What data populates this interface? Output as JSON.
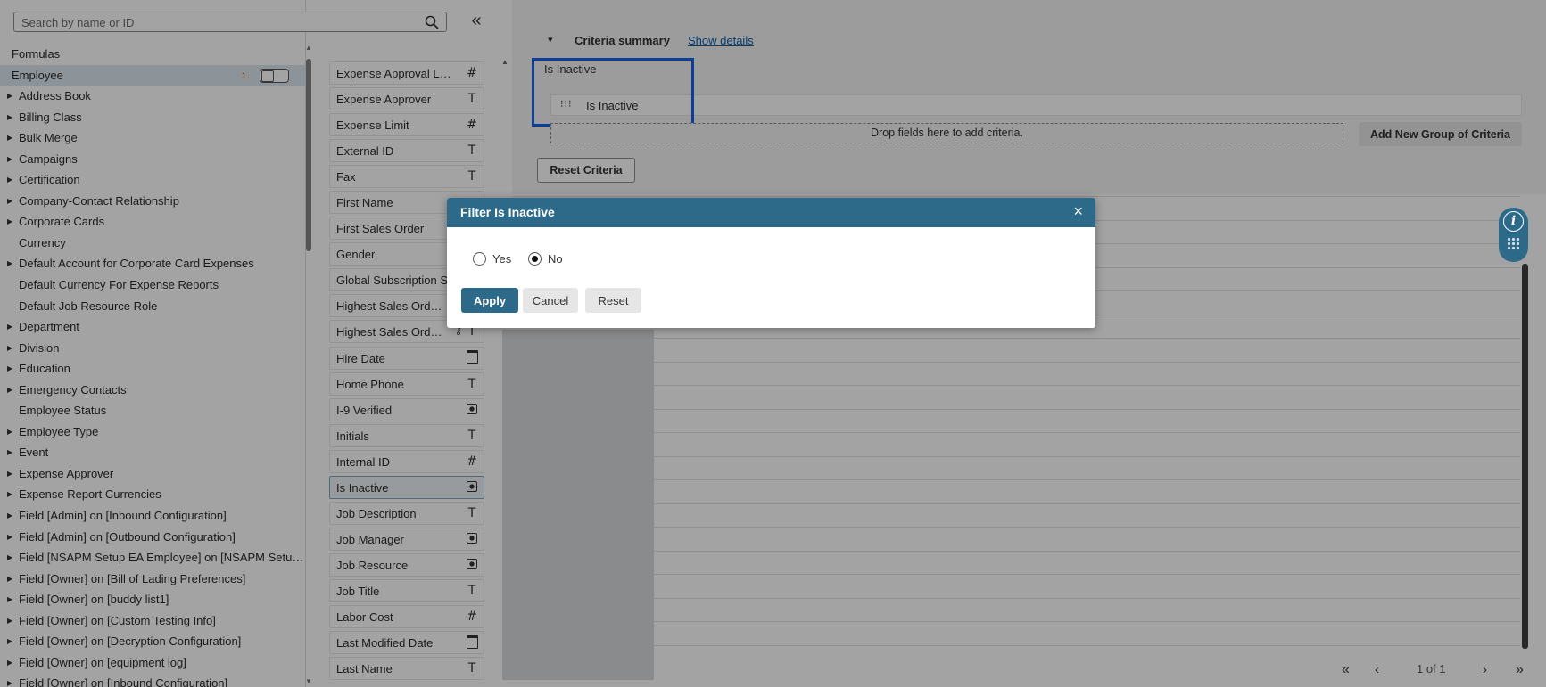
{
  "search": {
    "placeholder": "Search by name or ID"
  },
  "icons": {
    "search": "search-icon",
    "collapse": "double-chevron-left-icon",
    "info": "info-icon",
    "grid": "grid-icon",
    "close": "close-icon"
  },
  "colors": {
    "accent": "#2d6a8a",
    "highlight_border": "#1261e8",
    "link": "#0a5db0",
    "selected_row": "#dde8ef"
  },
  "tree": {
    "formulas_label": "Formulas",
    "employee_label": "Employee",
    "employee_badge": "1",
    "items": [
      {
        "label": "Address Book",
        "expandable": true
      },
      {
        "label": "Billing Class",
        "expandable": true
      },
      {
        "label": "Bulk Merge",
        "expandable": true
      },
      {
        "label": "Campaigns",
        "expandable": true
      },
      {
        "label": "Certification",
        "expandable": true
      },
      {
        "label": "Company-Contact Relationship",
        "expandable": true
      },
      {
        "label": "Corporate Cards",
        "expandable": true
      },
      {
        "label": "Currency",
        "expandable": false
      },
      {
        "label": "Default Account for Corporate Card Expenses",
        "expandable": true
      },
      {
        "label": "Default Currency For Expense Reports",
        "expandable": false
      },
      {
        "label": "Default Job Resource Role",
        "expandable": false
      },
      {
        "label": "Department",
        "expandable": true
      },
      {
        "label": "Division",
        "expandable": true
      },
      {
        "label": "Education",
        "expandable": true
      },
      {
        "label": "Emergency Contacts",
        "expandable": true
      },
      {
        "label": "Employee Status",
        "expandable": false
      },
      {
        "label": "Employee Type",
        "expandable": true
      },
      {
        "label": "Event",
        "expandable": true
      },
      {
        "label": "Expense Approver",
        "expandable": true
      },
      {
        "label": "Expense Report Currencies",
        "expandable": true
      },
      {
        "label": "Field [Admin] on [Inbound Configuration]",
        "expandable": true
      },
      {
        "label": "Field [Admin] on [Outbound Configuration]",
        "expandable": true
      },
      {
        "label": "Field [NSAPM Setup EA Employee] on [NSAPM Setu…",
        "expandable": true
      },
      {
        "label": "Field [Owner] on [Bill of Lading Preferences]",
        "expandable": true
      },
      {
        "label": "Field [Owner] on [buddy list1]",
        "expandable": true
      },
      {
        "label": "Field [Owner] on [Custom Testing Info]",
        "expandable": true
      },
      {
        "label": "Field [Owner] on [Decryption Configuration]",
        "expandable": true
      },
      {
        "label": "Field [Owner] on [equipment log]",
        "expandable": true
      },
      {
        "label": "Field [Owner] on [Inbound Configuration]",
        "expandable": true
      }
    ]
  },
  "fields": [
    {
      "label": "Expense Approval Limit",
      "type": "#"
    },
    {
      "label": "Expense Approver",
      "type": "T"
    },
    {
      "label": "Expense Limit",
      "type": "#"
    },
    {
      "label": "External ID",
      "type": "T"
    },
    {
      "label": "Fax",
      "type": "T"
    },
    {
      "label": "First Name",
      "type": ""
    },
    {
      "label": "First Sales Order",
      "type": ""
    },
    {
      "label": "Gender",
      "type": ""
    },
    {
      "label": "Global Subscription S",
      "type": ""
    },
    {
      "label": "Highest Sales Ord…",
      "type": ""
    },
    {
      "label": "Highest Sales Ord…",
      "type": "T",
      "key": true
    },
    {
      "label": "Hire Date",
      "type": "date"
    },
    {
      "label": "Home Phone",
      "type": "T"
    },
    {
      "label": "I-9 Verified",
      "type": "check"
    },
    {
      "label": "Initials",
      "type": "T"
    },
    {
      "label": "Internal ID",
      "type": "#"
    },
    {
      "label": "Is Inactive",
      "type": "check",
      "selected": true
    },
    {
      "label": "Job Description",
      "type": "T"
    },
    {
      "label": "Job Manager",
      "type": "check"
    },
    {
      "label": "Job Resource",
      "type": "check"
    },
    {
      "label": "Job Title",
      "type": "T"
    },
    {
      "label": "Labor Cost",
      "type": "#"
    },
    {
      "label": "Last Modified Date",
      "type": "date"
    },
    {
      "label": "Last Name",
      "type": "T"
    }
  ],
  "criteria": {
    "title": "Criteria summary",
    "show_details": "Show details",
    "group_label": "Is Inactive",
    "field_label": "Is Inactive",
    "drop_hint": "Drop fields here to add criteria.",
    "add_group": "Add New Group of Criteria",
    "reset": "Reset Criteria"
  },
  "pager": {
    "text": "1 of 1",
    "first": "«",
    "prev": "‹",
    "next": "›",
    "last": "»"
  },
  "dialog": {
    "title": "Filter Is Inactive",
    "close": "×",
    "options": [
      {
        "label": "Yes",
        "checked": false
      },
      {
        "label": "No",
        "checked": true
      }
    ],
    "apply": "Apply",
    "cancel": "Cancel",
    "reset": "Reset"
  }
}
